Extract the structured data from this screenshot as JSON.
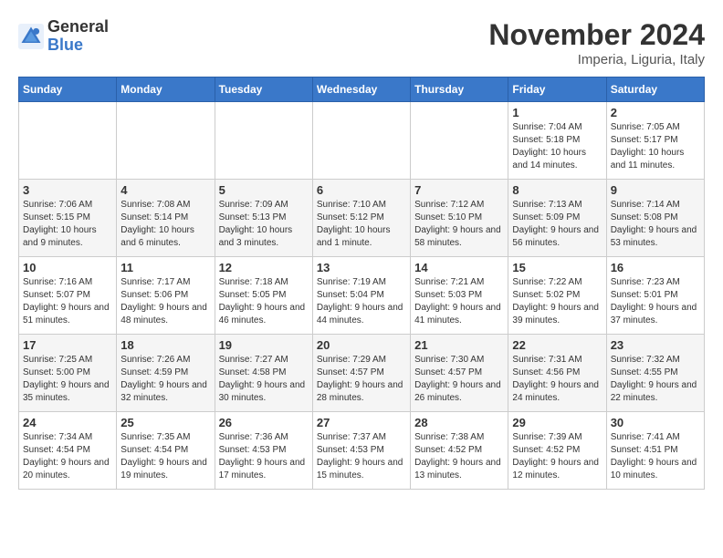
{
  "header": {
    "logo_line1": "General",
    "logo_line2": "Blue",
    "month_title": "November 2024",
    "location": "Imperia, Liguria, Italy"
  },
  "days_of_week": [
    "Sunday",
    "Monday",
    "Tuesday",
    "Wednesday",
    "Thursday",
    "Friday",
    "Saturday"
  ],
  "weeks": [
    [
      {
        "day": "",
        "info": ""
      },
      {
        "day": "",
        "info": ""
      },
      {
        "day": "",
        "info": ""
      },
      {
        "day": "",
        "info": ""
      },
      {
        "day": "",
        "info": ""
      },
      {
        "day": "1",
        "info": "Sunrise: 7:04 AM\nSunset: 5:18 PM\nDaylight: 10 hours and 14 minutes."
      },
      {
        "day": "2",
        "info": "Sunrise: 7:05 AM\nSunset: 5:17 PM\nDaylight: 10 hours and 11 minutes."
      }
    ],
    [
      {
        "day": "3",
        "info": "Sunrise: 7:06 AM\nSunset: 5:15 PM\nDaylight: 10 hours and 9 minutes."
      },
      {
        "day": "4",
        "info": "Sunrise: 7:08 AM\nSunset: 5:14 PM\nDaylight: 10 hours and 6 minutes."
      },
      {
        "day": "5",
        "info": "Sunrise: 7:09 AM\nSunset: 5:13 PM\nDaylight: 10 hours and 3 minutes."
      },
      {
        "day": "6",
        "info": "Sunrise: 7:10 AM\nSunset: 5:12 PM\nDaylight: 10 hours and 1 minute."
      },
      {
        "day": "7",
        "info": "Sunrise: 7:12 AM\nSunset: 5:10 PM\nDaylight: 9 hours and 58 minutes."
      },
      {
        "day": "8",
        "info": "Sunrise: 7:13 AM\nSunset: 5:09 PM\nDaylight: 9 hours and 56 minutes."
      },
      {
        "day": "9",
        "info": "Sunrise: 7:14 AM\nSunset: 5:08 PM\nDaylight: 9 hours and 53 minutes."
      }
    ],
    [
      {
        "day": "10",
        "info": "Sunrise: 7:16 AM\nSunset: 5:07 PM\nDaylight: 9 hours and 51 minutes."
      },
      {
        "day": "11",
        "info": "Sunrise: 7:17 AM\nSunset: 5:06 PM\nDaylight: 9 hours and 48 minutes."
      },
      {
        "day": "12",
        "info": "Sunrise: 7:18 AM\nSunset: 5:05 PM\nDaylight: 9 hours and 46 minutes."
      },
      {
        "day": "13",
        "info": "Sunrise: 7:19 AM\nSunset: 5:04 PM\nDaylight: 9 hours and 44 minutes."
      },
      {
        "day": "14",
        "info": "Sunrise: 7:21 AM\nSunset: 5:03 PM\nDaylight: 9 hours and 41 minutes."
      },
      {
        "day": "15",
        "info": "Sunrise: 7:22 AM\nSunset: 5:02 PM\nDaylight: 9 hours and 39 minutes."
      },
      {
        "day": "16",
        "info": "Sunrise: 7:23 AM\nSunset: 5:01 PM\nDaylight: 9 hours and 37 minutes."
      }
    ],
    [
      {
        "day": "17",
        "info": "Sunrise: 7:25 AM\nSunset: 5:00 PM\nDaylight: 9 hours and 35 minutes."
      },
      {
        "day": "18",
        "info": "Sunrise: 7:26 AM\nSunset: 4:59 PM\nDaylight: 9 hours and 32 minutes."
      },
      {
        "day": "19",
        "info": "Sunrise: 7:27 AM\nSunset: 4:58 PM\nDaylight: 9 hours and 30 minutes."
      },
      {
        "day": "20",
        "info": "Sunrise: 7:29 AM\nSunset: 4:57 PM\nDaylight: 9 hours and 28 minutes."
      },
      {
        "day": "21",
        "info": "Sunrise: 7:30 AM\nSunset: 4:57 PM\nDaylight: 9 hours and 26 minutes."
      },
      {
        "day": "22",
        "info": "Sunrise: 7:31 AM\nSunset: 4:56 PM\nDaylight: 9 hours and 24 minutes."
      },
      {
        "day": "23",
        "info": "Sunrise: 7:32 AM\nSunset: 4:55 PM\nDaylight: 9 hours and 22 minutes."
      }
    ],
    [
      {
        "day": "24",
        "info": "Sunrise: 7:34 AM\nSunset: 4:54 PM\nDaylight: 9 hours and 20 minutes."
      },
      {
        "day": "25",
        "info": "Sunrise: 7:35 AM\nSunset: 4:54 PM\nDaylight: 9 hours and 19 minutes."
      },
      {
        "day": "26",
        "info": "Sunrise: 7:36 AM\nSunset: 4:53 PM\nDaylight: 9 hours and 17 minutes."
      },
      {
        "day": "27",
        "info": "Sunrise: 7:37 AM\nSunset: 4:53 PM\nDaylight: 9 hours and 15 minutes."
      },
      {
        "day": "28",
        "info": "Sunrise: 7:38 AM\nSunset: 4:52 PM\nDaylight: 9 hours and 13 minutes."
      },
      {
        "day": "29",
        "info": "Sunrise: 7:39 AM\nSunset: 4:52 PM\nDaylight: 9 hours and 12 minutes."
      },
      {
        "day": "30",
        "info": "Sunrise: 7:41 AM\nSunset: 4:51 PM\nDaylight: 9 hours and 10 minutes."
      }
    ]
  ]
}
